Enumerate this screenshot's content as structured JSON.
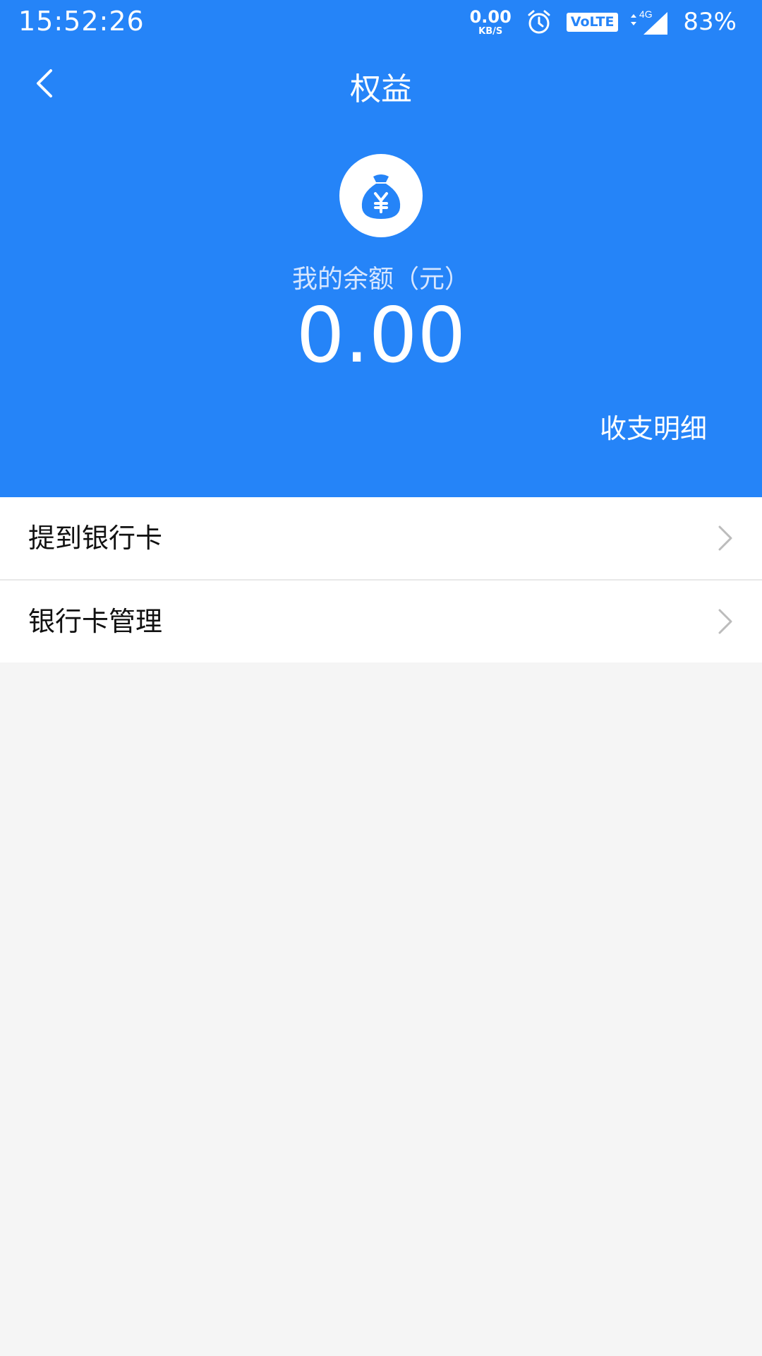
{
  "status_bar": {
    "time": "15:52:26",
    "net_speed_value": "0.00",
    "net_speed_unit": "KB/S",
    "volte_label": "VoLTE",
    "network_label": "4G",
    "battery": "83%",
    "icons": [
      "alarm-icon",
      "signal-icon"
    ]
  },
  "nav": {
    "title": "权益",
    "back_icon": "chevron-left-icon"
  },
  "balance": {
    "label": "我的余额（元）",
    "amount": "0.00",
    "icon": "money-bag-yen-icon",
    "detail_link": "收支明细"
  },
  "menu": {
    "items": [
      {
        "label": "提到银行卡",
        "icon": "chevron-right-icon"
      },
      {
        "label": "银行卡管理",
        "icon": "chevron-right-icon"
      }
    ]
  },
  "colors": {
    "header_bg": "#2584f8",
    "page_bg": "#f5f5f5"
  }
}
